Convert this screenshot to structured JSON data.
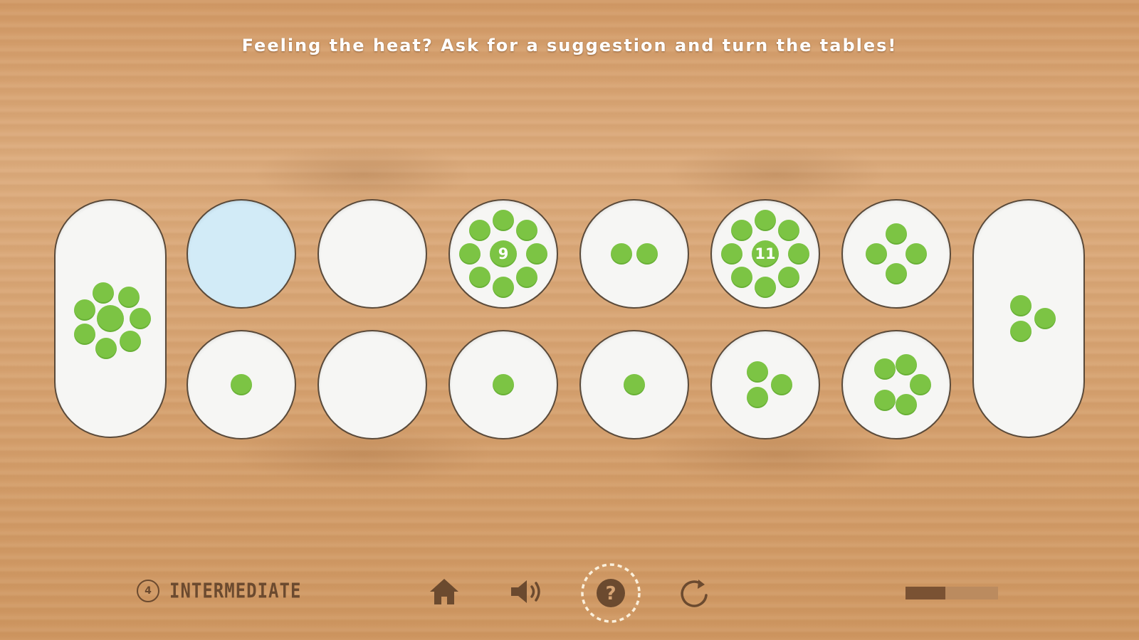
{
  "hint": {
    "text": "Feeling the heat? Ask for a suggestion and turn the tables!"
  },
  "board": {
    "left_store": {
      "seeds": 8
    },
    "right_store": {
      "seeds": 3
    },
    "top_row": [
      {
        "seeds": 0,
        "highlighted": true
      },
      {
        "seeds": 0
      },
      {
        "seeds": 9,
        "count_label": "9"
      },
      {
        "seeds": 2
      },
      {
        "seeds": 11,
        "count_label": "11"
      },
      {
        "seeds": 4
      }
    ],
    "bottom_row": [
      {
        "seeds": 1
      },
      {
        "seeds": 0
      },
      {
        "seeds": 1
      },
      {
        "seeds": 1
      },
      {
        "seeds": 3
      },
      {
        "seeds": 5
      }
    ]
  },
  "footer": {
    "level_number": "4",
    "level_name": "INTERMEDIATE",
    "progress": 0.43,
    "icons": [
      "home-icon",
      "speaker-icon",
      "help-icon",
      "restart-icon"
    ]
  },
  "colors": {
    "seed": "#7cc444",
    "pit": "#f6f6f4",
    "pit_highlight": "#d2ebf7",
    "icon": "#6b4a2f"
  }
}
